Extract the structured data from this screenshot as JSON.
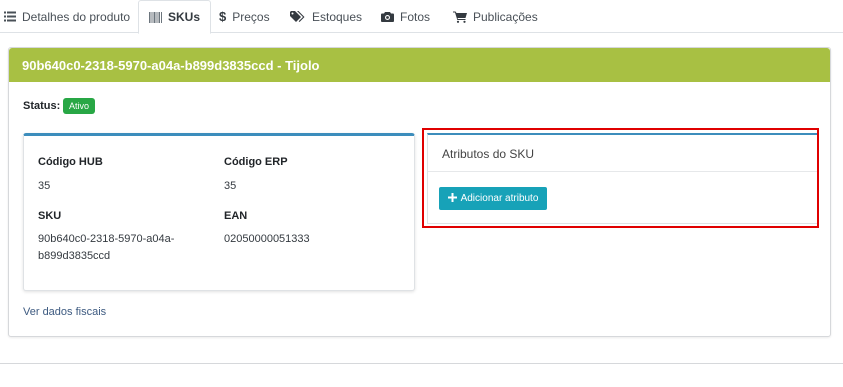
{
  "tabs": [
    {
      "label": "Detalhes do produto",
      "icon": "list-icon"
    },
    {
      "label": "SKUs",
      "icon": "barcode-icon",
      "active": true
    },
    {
      "label": "Preços",
      "icon": "dollar-icon"
    },
    {
      "label": "Estoques",
      "icon": "tags-icon"
    },
    {
      "label": "Fotos",
      "icon": "camera-icon"
    },
    {
      "label": "Publicações",
      "icon": "cart-icon"
    }
  ],
  "card": {
    "title": "90b640c0-2318-5970-a04a-b899d3835ccd - Tijolo",
    "header_color": "#a8c043",
    "status_label": "Status:",
    "status_value": "Ativo",
    "status_color": "#28a745"
  },
  "info": {
    "hub_label": "Código HUB",
    "hub_value": "35",
    "erp_label": "Código ERP",
    "erp_value": "35",
    "sku_label": "SKU",
    "sku_value_line1": "90b640c0-2318-5970-a04a-",
    "sku_value_line2": "b899d3835ccd",
    "ean_label": "EAN",
    "ean_value": "02050000051333"
  },
  "attributes": {
    "title": "Atributos do SKU",
    "add_button": "Adicionar atributo",
    "button_color": "#17a2b8"
  },
  "footer": {
    "fiscal_link": "Ver dados fiscais"
  }
}
